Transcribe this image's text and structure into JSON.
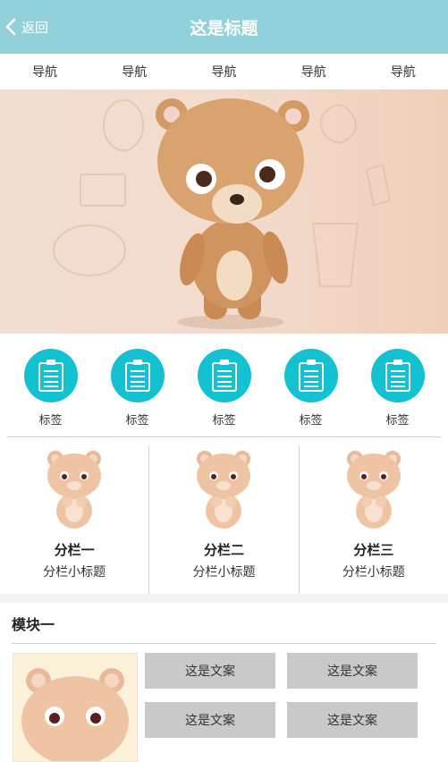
{
  "header": {
    "back_label": "返回",
    "title": "这是标题"
  },
  "nav": {
    "items": [
      "导航",
      "导航",
      "导航",
      "导航",
      "导航"
    ]
  },
  "labels": {
    "items": [
      "标签",
      "标签",
      "标签",
      "标签",
      "标签"
    ]
  },
  "columns": [
    {
      "title": "分栏一",
      "subtitle": "分栏小标题"
    },
    {
      "title": "分栏二",
      "subtitle": "分栏小标题"
    },
    {
      "title": "分栏三",
      "subtitle": "分栏小标题"
    }
  ],
  "module": {
    "title": "模块一",
    "copies": [
      "这是文案",
      "这是文案",
      "这是文案",
      "这是文案"
    ]
  },
  "colors": {
    "header_bg": "#91d1da",
    "label_circle": "#13c1d0",
    "copy_bg": "#c9c9c9"
  }
}
